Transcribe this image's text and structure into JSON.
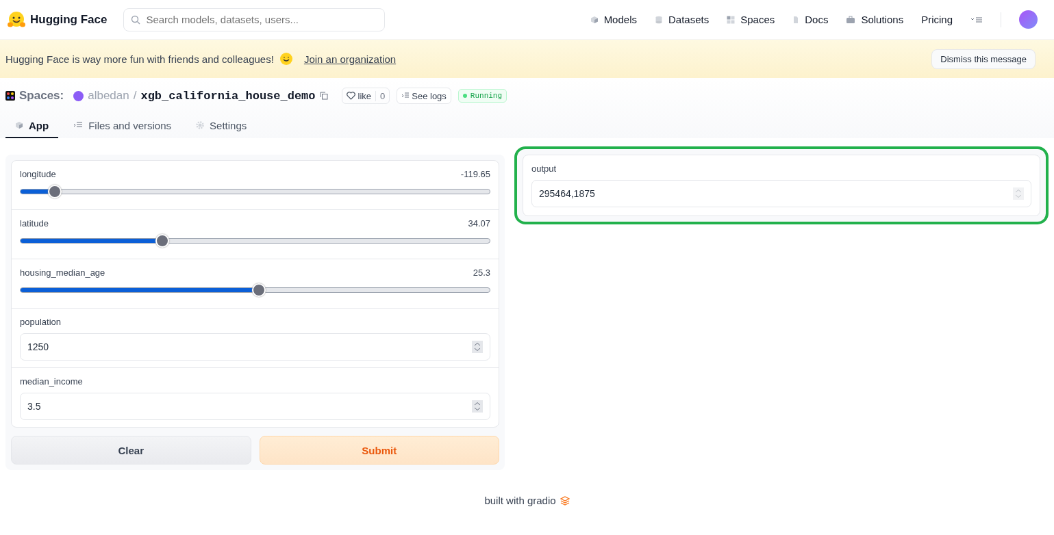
{
  "header": {
    "brand": "Hugging Face",
    "search": {
      "placeholder": "Search models, datasets, users..."
    },
    "nav": [
      {
        "label": "Models"
      },
      {
        "label": "Datasets"
      },
      {
        "label": "Spaces"
      },
      {
        "label": "Docs"
      },
      {
        "label": "Solutions"
      },
      {
        "label": "Pricing"
      }
    ]
  },
  "banner": {
    "message": "Hugging Face is way more fun with friends and colleagues!",
    "link": "Join an organization",
    "dismiss": "Dismiss this message"
  },
  "space": {
    "label": "Spaces:",
    "owner": "albedan",
    "separator": "/",
    "name": "xgb_california_house_demo",
    "like_label": "like",
    "like_count": "0",
    "logs": "See logs",
    "status": "Running"
  },
  "tabs": [
    {
      "label": "App",
      "selected": true
    },
    {
      "label": "Files and versions",
      "selected": false
    },
    {
      "label": "Settings",
      "selected": false
    }
  ],
  "inputs": [
    {
      "kind": "slider",
      "label": "longitude",
      "value": "-119.65",
      "level": 0.071
    },
    {
      "kind": "slider",
      "label": "latitude",
      "value": "34.07",
      "level": 0.3
    },
    {
      "kind": "slider",
      "label": "housing_median_age",
      "value": "25.3",
      "level": 0.506
    },
    {
      "kind": "number",
      "label": "population",
      "value": "1250"
    },
    {
      "kind": "number",
      "label": "median_income",
      "value": "3.5"
    }
  ],
  "buttons": [
    {
      "label": "Clear",
      "kind": "secondary"
    },
    {
      "label": "Submit",
      "kind": "primary"
    }
  ],
  "output": {
    "label": "output",
    "value": "295464,1875",
    "highlighted": true
  },
  "footer": {
    "text": "built with gradio"
  }
}
